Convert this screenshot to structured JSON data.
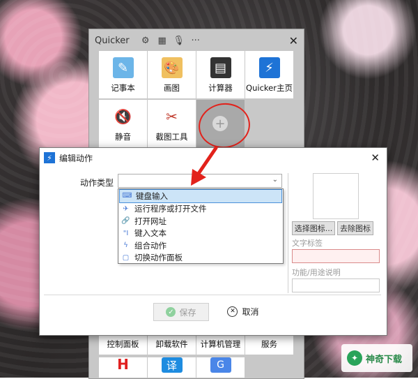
{
  "quicker": {
    "title": "Quicker",
    "tiles_row1": [
      {
        "label": "记事本",
        "icon": "notepad-icon"
      },
      {
        "label": "画图",
        "icon": "paint-palette-icon"
      },
      {
        "label": "计算器",
        "icon": "calculator-icon"
      },
      {
        "label": "Quicker主页",
        "icon": "quicker-bolt-icon"
      }
    ],
    "tiles_row2": [
      {
        "label": "静音",
        "icon": "mute-speaker-icon"
      },
      {
        "label": "截图工具",
        "icon": "scissors-icon"
      },
      {
        "label": "",
        "icon": "plus-icon"
      }
    ],
    "tiles_bottom": [
      {
        "label": "控制面板"
      },
      {
        "label": "卸载软件"
      },
      {
        "label": "计算机管理"
      },
      {
        "label": "服务"
      }
    ]
  },
  "dialog": {
    "title": "编辑动作",
    "type_label": "动作类型",
    "select_value": "",
    "options": [
      {
        "label": "键盘输入",
        "icon": "keyboard-icon",
        "selected": true
      },
      {
        "label": "运行程序或打开文件",
        "icon": "run-program-icon",
        "selected": false
      },
      {
        "label": "打开网址",
        "icon": "link-icon",
        "selected": false
      },
      {
        "label": "键入文本",
        "icon": "text-quote-icon",
        "selected": false
      },
      {
        "label": "组合动作",
        "icon": "combo-bolt-icon",
        "selected": false
      },
      {
        "label": "切换动作面板",
        "icon": "panel-icon",
        "selected": false
      }
    ],
    "choose_icon_label": "选择图标...",
    "remove_icon_label": "去除图标",
    "text_label_title": "文字标签",
    "desc_title": "功能/用途说明",
    "save_label": "保存",
    "cancel_label": "取消"
  },
  "watermark": {
    "text": "神奇下载"
  },
  "colors": {
    "accent_red": "#e2221b",
    "quicker_blue": "#1e73d6",
    "selection": "#cce4f7"
  }
}
